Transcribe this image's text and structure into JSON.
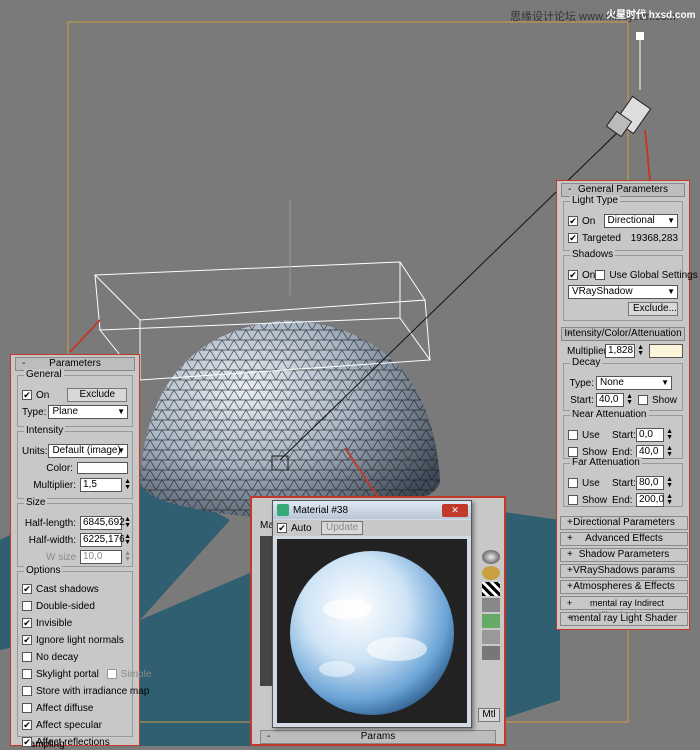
{
  "watermark": "思缘设计论坛  www.missyuan.com",
  "logo_text": "火星时代 hxsd.com",
  "left_panel": {
    "title": "Parameters",
    "toggle": "-",
    "general": {
      "label": "General",
      "on_label": "On",
      "exclude_label": "Exclude",
      "type_label": "Type:",
      "type_value": "Plane"
    },
    "intensity": {
      "label": "Intensity",
      "units_label": "Units:",
      "units_value": "Default (image)",
      "color_label": "Color:",
      "multiplier_label": "Multiplier:",
      "multiplier_value": "1,5"
    },
    "size": {
      "label": "Size",
      "half_length_label": "Half-length:",
      "half_length_value": "6845,692",
      "half_width_label": "Half-width:",
      "half_width_value": "6225,176",
      "w_size_label": "W size",
      "w_size_value": "10,0"
    },
    "options": {
      "label": "Options",
      "items": [
        {
          "label": "Cast shadows",
          "checked": "✔"
        },
        {
          "label": "Double-sided",
          "checked": ""
        },
        {
          "label": "Invisible",
          "checked": "✔"
        },
        {
          "label": "Ignore light normals",
          "checked": "✔"
        },
        {
          "label": "No decay",
          "checked": ""
        },
        {
          "label": "Skylight portal",
          "checked": ""
        },
        {
          "label": "Store with irradiance map",
          "checked": ""
        },
        {
          "label": "Affect diffuse",
          "checked": ""
        },
        {
          "label": "Affect specular",
          "checked": "✔"
        },
        {
          "label": "Affect reflections",
          "checked": "✔"
        }
      ],
      "simple_label": "Simple"
    },
    "sampling_label": "Sampling"
  },
  "right_panel": {
    "title": "General Parameters",
    "toggle": "-",
    "light_type": {
      "label": "Light Type",
      "on_label": "On",
      "type_value": "Directional",
      "targeted_label": "Targeted",
      "targeted_value": "19368,283"
    },
    "shadows": {
      "label": "Shadows",
      "on_label": "On",
      "use_global_label": "Use Global Settings",
      "shadow_type": "VRayShadow",
      "exclude_label": "Exclude..."
    },
    "intensity_title": "Intensity/Color/Attenuation",
    "multiplier_label": "Multiplier:",
    "multiplier_value": "1,828",
    "decay": {
      "label": "Decay",
      "type_label": "Type:",
      "type_value": "None",
      "start_label": "Start:",
      "start_value": "40,0",
      "show_label": "Show"
    },
    "near": {
      "label": "Near Attenuation",
      "use_label": "Use",
      "show_label": "Show",
      "start_label": "Start:",
      "start_value": "0,0",
      "end_label": "End:",
      "end_value": "40,0"
    },
    "far": {
      "label": "Far Attenuation",
      "use_label": "Use",
      "show_label": "Show",
      "start_label": "Start:",
      "start_value": "80,0",
      "end_label": "End:",
      "end_value": "200,0"
    },
    "collapsed": [
      "Directional Parameters",
      "Advanced Effects",
      "Shadow Parameters",
      "VRayShadows params",
      "Atmospheres & Effects",
      "mental ray Indirect Illumination",
      "mental ray Light Shader"
    ],
    "collapsed_toggle": "+"
  },
  "material_window": {
    "title": "Material #38",
    "auto_label": "Auto",
    "update_label": "Update",
    "params_label": "Params",
    "back_tab": "Ma",
    "side_btn": "Mtl"
  },
  "colors": {
    "background": "#7a7a7a",
    "ground": "#2f5f70",
    "accent": "#c0392b",
    "gizmo": "#c8a040",
    "light_color": "#fdf4dc"
  }
}
